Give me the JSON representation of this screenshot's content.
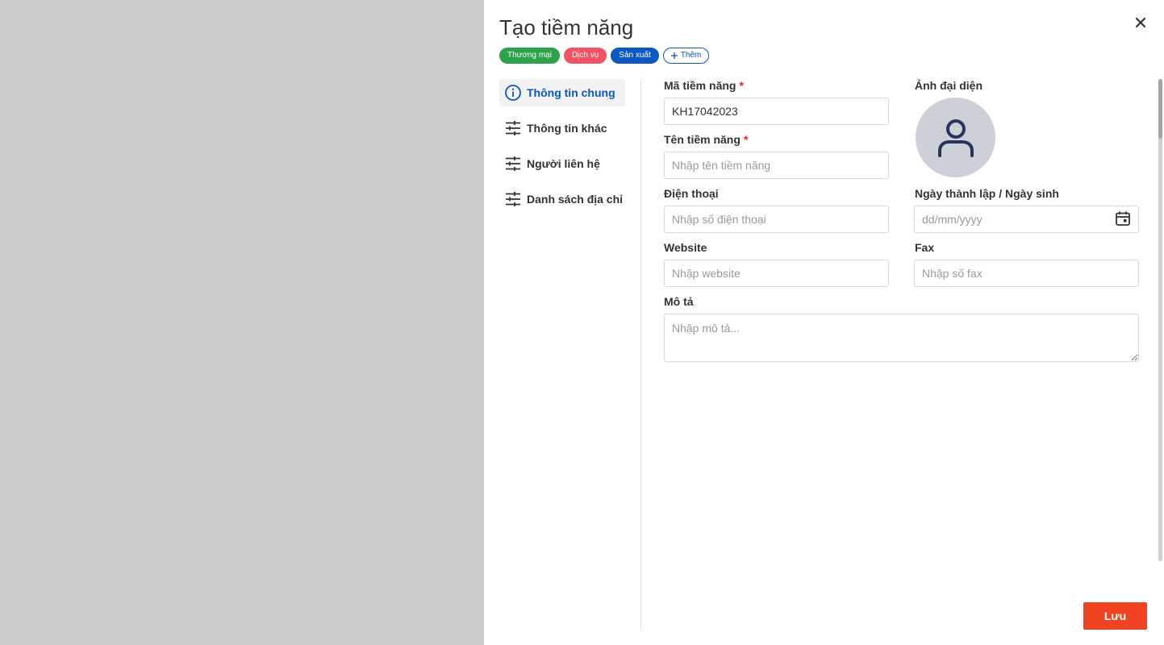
{
  "dialog": {
    "title": "Tạo tiềm năng",
    "close_icon": "close-icon"
  },
  "tags": [
    {
      "label": "Thương mại",
      "color": "#2ca24c"
    },
    {
      "label": "Dịch vụ",
      "color": "#f25266"
    },
    {
      "label": "Sản xuất",
      "color": "#0b58c4"
    }
  ],
  "add_tag": {
    "label": "Thêm",
    "icon": "plus-icon"
  },
  "nav": [
    {
      "label": "Thông tin chung",
      "icon": "info-icon",
      "active": true
    },
    {
      "label": "Thông tin khác",
      "icon": "sliders-icon",
      "active": false
    },
    {
      "label": "Người liên hệ",
      "icon": "sliders-icon",
      "active": false
    },
    {
      "label": "Danh sách địa chỉ",
      "icon": "sliders-icon",
      "active": false
    }
  ],
  "form": {
    "code": {
      "label": "Mã tiềm năng",
      "required_mark": "*",
      "value": "KH17042023"
    },
    "name": {
      "label": "Tên tiềm năng",
      "required_mark": "*",
      "placeholder": "Nhập tên tiềm năng"
    },
    "phone": {
      "label": "Điện thoại",
      "placeholder": "Nhập số điện thoại"
    },
    "website": {
      "label": "Website",
      "placeholder": "Nhập website"
    },
    "avatar": {
      "label": "Ảnh đại diện",
      "icon": "user-icon"
    },
    "date": {
      "label": "Ngày thành lập / Ngày sinh",
      "placeholder": "dd/mm/yyyy",
      "icon": "calendar-icon"
    },
    "fax": {
      "label": "Fax",
      "placeholder": "Nhập số fax"
    },
    "description": {
      "label": "Mô tả",
      "placeholder": "Nhập mô tả..."
    }
  },
  "footer": {
    "save_label": "Lưu"
  },
  "colors": {
    "accent": "#0b58c4",
    "save": "#f04321",
    "required": "#e02424"
  }
}
